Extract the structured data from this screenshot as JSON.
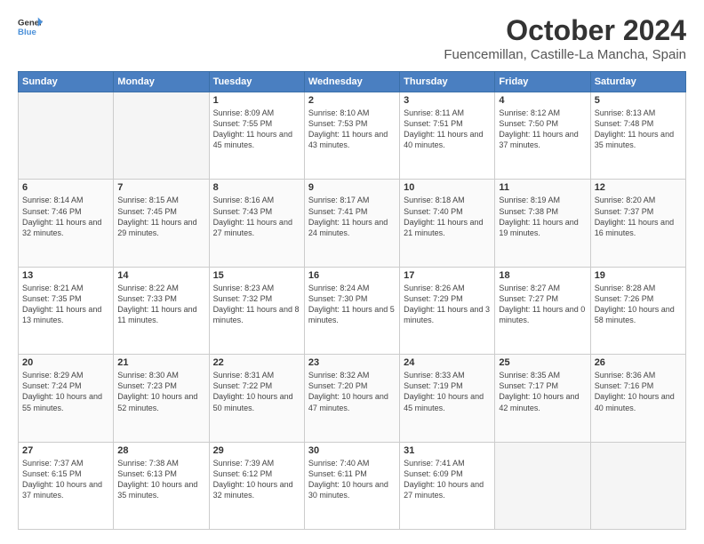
{
  "logo": {
    "general": "General",
    "blue": "Blue"
  },
  "title": "October 2024",
  "location": "Fuencemillan, Castille-La Mancha, Spain",
  "headers": [
    "Sunday",
    "Monday",
    "Tuesday",
    "Wednesday",
    "Thursday",
    "Friday",
    "Saturday"
  ],
  "weeks": [
    [
      {
        "day": "",
        "info": ""
      },
      {
        "day": "",
        "info": ""
      },
      {
        "day": "1",
        "info": "Sunrise: 8:09 AM\nSunset: 7:55 PM\nDaylight: 11 hours and 45 minutes."
      },
      {
        "day": "2",
        "info": "Sunrise: 8:10 AM\nSunset: 7:53 PM\nDaylight: 11 hours and 43 minutes."
      },
      {
        "day": "3",
        "info": "Sunrise: 8:11 AM\nSunset: 7:51 PM\nDaylight: 11 hours and 40 minutes."
      },
      {
        "day": "4",
        "info": "Sunrise: 8:12 AM\nSunset: 7:50 PM\nDaylight: 11 hours and 37 minutes."
      },
      {
        "day": "5",
        "info": "Sunrise: 8:13 AM\nSunset: 7:48 PM\nDaylight: 11 hours and 35 minutes."
      }
    ],
    [
      {
        "day": "6",
        "info": "Sunrise: 8:14 AM\nSunset: 7:46 PM\nDaylight: 11 hours and 32 minutes."
      },
      {
        "day": "7",
        "info": "Sunrise: 8:15 AM\nSunset: 7:45 PM\nDaylight: 11 hours and 29 minutes."
      },
      {
        "day": "8",
        "info": "Sunrise: 8:16 AM\nSunset: 7:43 PM\nDaylight: 11 hours and 27 minutes."
      },
      {
        "day": "9",
        "info": "Sunrise: 8:17 AM\nSunset: 7:41 PM\nDaylight: 11 hours and 24 minutes."
      },
      {
        "day": "10",
        "info": "Sunrise: 8:18 AM\nSunset: 7:40 PM\nDaylight: 11 hours and 21 minutes."
      },
      {
        "day": "11",
        "info": "Sunrise: 8:19 AM\nSunset: 7:38 PM\nDaylight: 11 hours and 19 minutes."
      },
      {
        "day": "12",
        "info": "Sunrise: 8:20 AM\nSunset: 7:37 PM\nDaylight: 11 hours and 16 minutes."
      }
    ],
    [
      {
        "day": "13",
        "info": "Sunrise: 8:21 AM\nSunset: 7:35 PM\nDaylight: 11 hours and 13 minutes."
      },
      {
        "day": "14",
        "info": "Sunrise: 8:22 AM\nSunset: 7:33 PM\nDaylight: 11 hours and 11 minutes."
      },
      {
        "day": "15",
        "info": "Sunrise: 8:23 AM\nSunset: 7:32 PM\nDaylight: 11 hours and 8 minutes."
      },
      {
        "day": "16",
        "info": "Sunrise: 8:24 AM\nSunset: 7:30 PM\nDaylight: 11 hours and 5 minutes."
      },
      {
        "day": "17",
        "info": "Sunrise: 8:26 AM\nSunset: 7:29 PM\nDaylight: 11 hours and 3 minutes."
      },
      {
        "day": "18",
        "info": "Sunrise: 8:27 AM\nSunset: 7:27 PM\nDaylight: 11 hours and 0 minutes."
      },
      {
        "day": "19",
        "info": "Sunrise: 8:28 AM\nSunset: 7:26 PM\nDaylight: 10 hours and 58 minutes."
      }
    ],
    [
      {
        "day": "20",
        "info": "Sunrise: 8:29 AM\nSunset: 7:24 PM\nDaylight: 10 hours and 55 minutes."
      },
      {
        "day": "21",
        "info": "Sunrise: 8:30 AM\nSunset: 7:23 PM\nDaylight: 10 hours and 52 minutes."
      },
      {
        "day": "22",
        "info": "Sunrise: 8:31 AM\nSunset: 7:22 PM\nDaylight: 10 hours and 50 minutes."
      },
      {
        "day": "23",
        "info": "Sunrise: 8:32 AM\nSunset: 7:20 PM\nDaylight: 10 hours and 47 minutes."
      },
      {
        "day": "24",
        "info": "Sunrise: 8:33 AM\nSunset: 7:19 PM\nDaylight: 10 hours and 45 minutes."
      },
      {
        "day": "25",
        "info": "Sunrise: 8:35 AM\nSunset: 7:17 PM\nDaylight: 10 hours and 42 minutes."
      },
      {
        "day": "26",
        "info": "Sunrise: 8:36 AM\nSunset: 7:16 PM\nDaylight: 10 hours and 40 minutes."
      }
    ],
    [
      {
        "day": "27",
        "info": "Sunrise: 7:37 AM\nSunset: 6:15 PM\nDaylight: 10 hours and 37 minutes."
      },
      {
        "day": "28",
        "info": "Sunrise: 7:38 AM\nSunset: 6:13 PM\nDaylight: 10 hours and 35 minutes."
      },
      {
        "day": "29",
        "info": "Sunrise: 7:39 AM\nSunset: 6:12 PM\nDaylight: 10 hours and 32 minutes."
      },
      {
        "day": "30",
        "info": "Sunrise: 7:40 AM\nSunset: 6:11 PM\nDaylight: 10 hours and 30 minutes."
      },
      {
        "day": "31",
        "info": "Sunrise: 7:41 AM\nSunset: 6:09 PM\nDaylight: 10 hours and 27 minutes."
      },
      {
        "day": "",
        "info": ""
      },
      {
        "day": "",
        "info": ""
      }
    ]
  ]
}
